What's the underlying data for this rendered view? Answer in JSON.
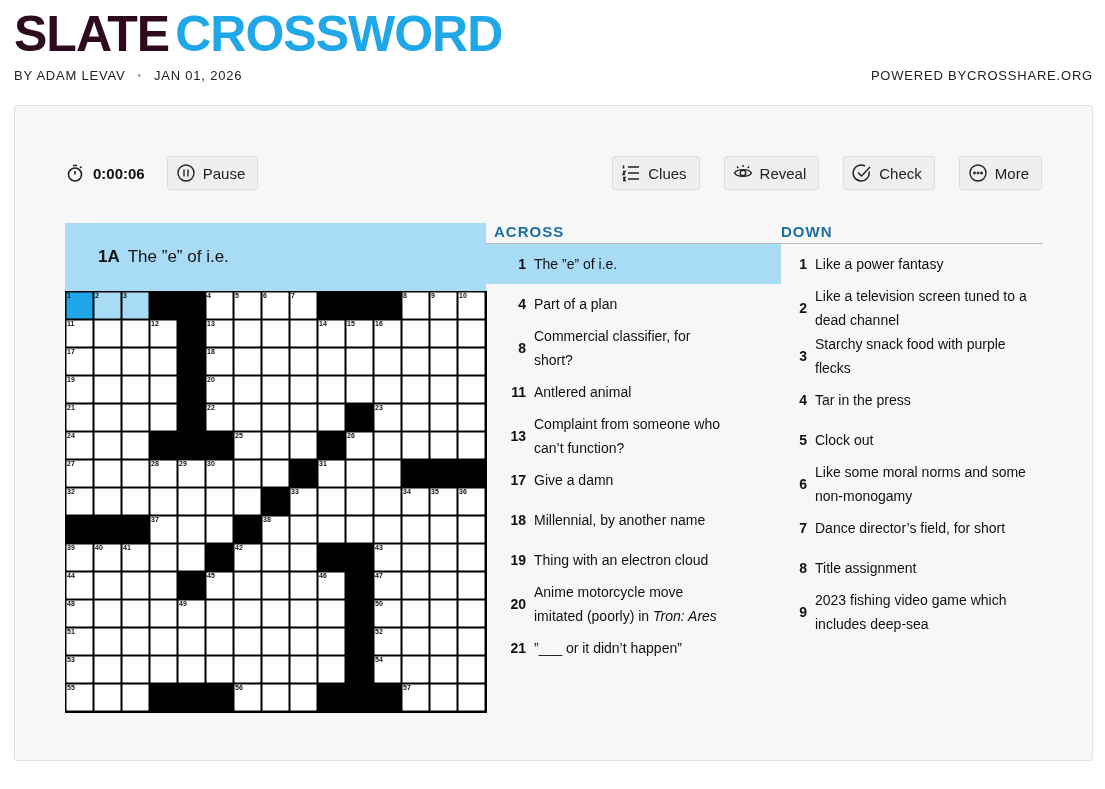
{
  "logo": {
    "part_1": "SLATE",
    "part_2": "CROSSWORD"
  },
  "byline": {
    "author": "BY ADAM LEVAV",
    "separator": "•",
    "date": "JAN 01, 2026",
    "powered": "POWERED BYCROSSHARE.ORG"
  },
  "toolbar": {
    "timer": "0:00:06",
    "pause": "Pause",
    "buttons": [
      {
        "kind": "clues",
        "label": "Clues"
      },
      {
        "kind": "reveal",
        "label": "Reveal"
      },
      {
        "kind": "check",
        "label": "Check"
      },
      {
        "kind": "more",
        "label": "More"
      }
    ]
  },
  "current_clue": {
    "number": "1A",
    "text": "The ”e” of i.e."
  },
  "grid": [
    [
      {
        "kind": "open",
        "number": "1",
        "selected": true
      },
      {
        "kind": "open",
        "number": "2",
        "highlighted": true
      },
      {
        "kind": "open",
        "number": "3",
        "highlighted": true
      },
      {
        "kind": "block"
      },
      {
        "kind": "block"
      },
      {
        "kind": "open",
        "number": "4"
      },
      {
        "kind": "open",
        "number": "5"
      },
      {
        "kind": "open",
        "number": "6"
      },
      {
        "kind": "open",
        "number": "7"
      },
      {
        "kind": "block"
      },
      {
        "kind": "block"
      },
      {
        "kind": "block"
      },
      {
        "kind": "open",
        "number": "8"
      },
      {
        "kind": "open",
        "number": "9"
      },
      {
        "kind": "open",
        "number": "10"
      }
    ],
    [
      {
        "kind": "open",
        "number": "11"
      },
      {
        "kind": "open"
      },
      {
        "kind": "open"
      },
      {
        "kind": "open",
        "number": "12"
      },
      {
        "kind": "block"
      },
      {
        "kind": "open",
        "number": "13"
      },
      {
        "kind": "open"
      },
      {
        "kind": "open"
      },
      {
        "kind": "open"
      },
      {
        "kind": "open",
        "number": "14"
      },
      {
        "kind": "open",
        "number": "15"
      },
      {
        "kind": "open",
        "number": "16"
      },
      {
        "kind": "open"
      },
      {
        "kind": "open"
      },
      {
        "kind": "open"
      }
    ],
    [
      {
        "kind": "open",
        "number": "17"
      },
      {
        "kind": "open"
      },
      {
        "kind": "open"
      },
      {
        "kind": "open"
      },
      {
        "kind": "block"
      },
      {
        "kind": "open",
        "number": "18"
      },
      {
        "kind": "open"
      },
      {
        "kind": "open"
      },
      {
        "kind": "open"
      },
      {
        "kind": "open"
      },
      {
        "kind": "open"
      },
      {
        "kind": "open"
      },
      {
        "kind": "open"
      },
      {
        "kind": "open"
      },
      {
        "kind": "open"
      }
    ],
    [
      {
        "kind": "open",
        "number": "19"
      },
      {
        "kind": "open"
      },
      {
        "kind": "open"
      },
      {
        "kind": "open"
      },
      {
        "kind": "block"
      },
      {
        "kind": "open",
        "number": "20"
      },
      {
        "kind": "open"
      },
      {
        "kind": "open"
      },
      {
        "kind": "open"
      },
      {
        "kind": "open"
      },
      {
        "kind": "open"
      },
      {
        "kind": "open"
      },
      {
        "kind": "open"
      },
      {
        "kind": "open"
      },
      {
        "kind": "open"
      }
    ],
    [
      {
        "kind": "open",
        "number": "21"
      },
      {
        "kind": "open"
      },
      {
        "kind": "open"
      },
      {
        "kind": "open"
      },
      {
        "kind": "block"
      },
      {
        "kind": "open",
        "number": "22"
      },
      {
        "kind": "open"
      },
      {
        "kind": "open"
      },
      {
        "kind": "open"
      },
      {
        "kind": "open"
      },
      {
        "kind": "block"
      },
      {
        "kind": "open",
        "number": "23"
      },
      {
        "kind": "open"
      },
      {
        "kind": "open"
      },
      {
        "kind": "open"
      }
    ],
    [
      {
        "kind": "open",
        "number": "24"
      },
      {
        "kind": "open"
      },
      {
        "kind": "open"
      },
      {
        "kind": "block"
      },
      {
        "kind": "block"
      },
      {
        "kind": "block"
      },
      {
        "kind": "open",
        "number": "25"
      },
      {
        "kind": "open"
      },
      {
        "kind": "open"
      },
      {
        "kind": "block"
      },
      {
        "kind": "open",
        "number": "26"
      },
      {
        "kind": "open"
      },
      {
        "kind": "open"
      },
      {
        "kind": "open"
      },
      {
        "kind": "open"
      }
    ],
    [
      {
        "kind": "open",
        "number": "27"
      },
      {
        "kind": "open"
      },
      {
        "kind": "open"
      },
      {
        "kind": "open",
        "number": "28"
      },
      {
        "kind": "open",
        "number": "29"
      },
      {
        "kind": "open",
        "number": "30"
      },
      {
        "kind": "open"
      },
      {
        "kind": "open"
      },
      {
        "kind": "block"
      },
      {
        "kind": "open",
        "number": "31"
      },
      {
        "kind": "open"
      },
      {
        "kind": "open"
      },
      {
        "kind": "block"
      },
      {
        "kind": "block"
      },
      {
        "kind": "block"
      }
    ],
    [
      {
        "kind": "open",
        "number": "32"
      },
      {
        "kind": "open"
      },
      {
        "kind": "open"
      },
      {
        "kind": "open"
      },
      {
        "kind": "open"
      },
      {
        "kind": "open"
      },
      {
        "kind": "open"
      },
      {
        "kind": "block"
      },
      {
        "kind": "open",
        "number": "33"
      },
      {
        "kind": "open"
      },
      {
        "kind": "open"
      },
      {
        "kind": "open"
      },
      {
        "kind": "open",
        "number": "34"
      },
      {
        "kind": "open",
        "number": "35"
      },
      {
        "kind": "open",
        "number": "36"
      }
    ],
    [
      {
        "kind": "block"
      },
      {
        "kind": "block"
      },
      {
        "kind": "block"
      },
      {
        "kind": "open",
        "number": "37"
      },
      {
        "kind": "open"
      },
      {
        "kind": "open"
      },
      {
        "kind": "block"
      },
      {
        "kind": "open",
        "number": "38"
      },
      {
        "kind": "open"
      },
      {
        "kind": "open"
      },
      {
        "kind": "open"
      },
      {
        "kind": "open"
      },
      {
        "kind": "open"
      },
      {
        "kind": "open"
      },
      {
        "kind": "open"
      }
    ],
    [
      {
        "kind": "open",
        "number": "39"
      },
      {
        "kind": "open",
        "number": "40"
      },
      {
        "kind": "open",
        "number": "41"
      },
      {
        "kind": "open"
      },
      {
        "kind": "open"
      },
      {
        "kind": "block"
      },
      {
        "kind": "open",
        "number": "42"
      },
      {
        "kind": "open"
      },
      {
        "kind": "open"
      },
      {
        "kind": "block"
      },
      {
        "kind": "block"
      },
      {
        "kind": "open",
        "number": "43"
      },
      {
        "kind": "open"
      },
      {
        "kind": "open"
      },
      {
        "kind": "open"
      }
    ],
    [
      {
        "kind": "open",
        "number": "44"
      },
      {
        "kind": "open"
      },
      {
        "kind": "open"
      },
      {
        "kind": "open"
      },
      {
        "kind": "block"
      },
      {
        "kind": "open",
        "number": "45"
      },
      {
        "kind": "open"
      },
      {
        "kind": "open"
      },
      {
        "kind": "open"
      },
      {
        "kind": "open",
        "number": "46"
      },
      {
        "kind": "block"
      },
      {
        "kind": "open",
        "number": "47"
      },
      {
        "kind": "open"
      },
      {
        "kind": "open"
      },
      {
        "kind": "open"
      }
    ],
    [
      {
        "kind": "open",
        "number": "48"
      },
      {
        "kind": "open"
      },
      {
        "kind": "open"
      },
      {
        "kind": "open"
      },
      {
        "kind": "open",
        "number": "49"
      },
      {
        "kind": "open"
      },
      {
        "kind": "open"
      },
      {
        "kind": "open"
      },
      {
        "kind": "open"
      },
      {
        "kind": "open"
      },
      {
        "kind": "block"
      },
      {
        "kind": "open",
        "number": "50"
      },
      {
        "kind": "open"
      },
      {
        "kind": "open"
      },
      {
        "kind": "open"
      }
    ],
    [
      {
        "kind": "open",
        "number": "51"
      },
      {
        "kind": "open"
      },
      {
        "kind": "open"
      },
      {
        "kind": "open"
      },
      {
        "kind": "open"
      },
      {
        "kind": "open"
      },
      {
        "kind": "open"
      },
      {
        "kind": "open"
      },
      {
        "kind": "open"
      },
      {
        "kind": "open"
      },
      {
        "kind": "block"
      },
      {
        "kind": "open",
        "number": "52"
      },
      {
        "kind": "open"
      },
      {
        "kind": "open"
      },
      {
        "kind": "open"
      }
    ],
    [
      {
        "kind": "open",
        "number": "53"
      },
      {
        "kind": "open"
      },
      {
        "kind": "open"
      },
      {
        "kind": "open"
      },
      {
        "kind": "open"
      },
      {
        "kind": "open"
      },
      {
        "kind": "open"
      },
      {
        "kind": "open"
      },
      {
        "kind": "open"
      },
      {
        "kind": "open"
      },
      {
        "kind": "block"
      },
      {
        "kind": "open",
        "number": "54"
      },
      {
        "kind": "open"
      },
      {
        "kind": "open"
      },
      {
        "kind": "open"
      }
    ],
    [
      {
        "kind": "open",
        "number": "55"
      },
      {
        "kind": "open"
      },
      {
        "kind": "open"
      },
      {
        "kind": "block"
      },
      {
        "kind": "block"
      },
      {
        "kind": "block"
      },
      {
        "kind": "open",
        "number": "56"
      },
      {
        "kind": "open"
      },
      {
        "kind": "open"
      },
      {
        "kind": "block"
      },
      {
        "kind": "block"
      },
      {
        "kind": "block"
      },
      {
        "kind": "open",
        "number": "57"
      },
      {
        "kind": "open"
      },
      {
        "kind": "open"
      }
    ]
  ],
  "across": {
    "heading": "ACROSS",
    "clues": [
      {
        "number": "1",
        "text": "The ”e” of i.e.",
        "selected": true
      },
      {
        "number": "4",
        "text": "Part of a plan",
        "selected": false
      },
      {
        "number": "8",
        "text": "Commercial classifier, for short?",
        "selected": false
      },
      {
        "number": "11",
        "text": "Antlered animal",
        "selected": false
      },
      {
        "number": "13",
        "text": "Complaint from someone who can’t function?",
        "selected": false
      },
      {
        "number": "17",
        "text": "Give a damn",
        "selected": false
      },
      {
        "number": "18",
        "text": "Millennial, by another name",
        "selected": false
      },
      {
        "number": "19",
        "text": "Thing with an electron cloud",
        "selected": false
      },
      {
        "number": "20",
        "text": "Anime motorcycle move imitated (poorly) in *Tron: Ares*",
        "selected": false
      },
      {
        "number": "21",
        "text": "”___ or it didn’t happen”",
        "selected": false
      }
    ]
  },
  "down": {
    "heading": "DOWN",
    "clues": [
      {
        "number": "1",
        "text": "Like a power fantasy",
        "selected": false
      },
      {
        "number": "2",
        "text": "Like a television screen tuned to a dead channel",
        "selected": false
      },
      {
        "number": "3",
        "text": "Starchy snack food with purple flecks",
        "selected": false
      },
      {
        "number": "4",
        "text": "Tar in the press",
        "selected": false
      },
      {
        "number": "5",
        "text": "Clock out",
        "selected": false
      },
      {
        "number": "6",
        "text": "Like some moral norms and some non-monogamy",
        "selected": false
      },
      {
        "number": "7",
        "text": "Dance director’s field, for short",
        "selected": false
      },
      {
        "number": "8",
        "text": "Title assignment",
        "selected": false
      },
      {
        "number": "9",
        "text": "2023 fishing video game which includes deep-sea",
        "selected": false
      }
    ]
  }
}
